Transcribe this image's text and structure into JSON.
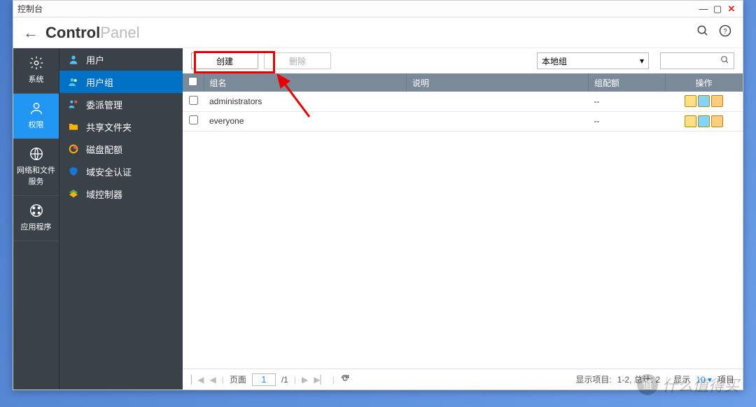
{
  "window": {
    "title": "控制台"
  },
  "header": {
    "brand_strong": "Control",
    "brand_light": "Panel"
  },
  "rail": {
    "items": [
      {
        "label": "系统"
      },
      {
        "label": "权限"
      },
      {
        "label": "网络和文件服务"
      },
      {
        "label": "应用程序"
      }
    ]
  },
  "sidebar": {
    "items": [
      {
        "label": "用户"
      },
      {
        "label": "用户组"
      },
      {
        "label": "委派管理"
      },
      {
        "label": "共享文件夹"
      },
      {
        "label": "磁盘配额"
      },
      {
        "label": "域安全认证"
      },
      {
        "label": "域控制器"
      }
    ]
  },
  "toolbar": {
    "create": "创建",
    "delete": "删除",
    "scope": "本地组"
  },
  "table": {
    "headers": {
      "name": "组名",
      "desc": "说明",
      "quota": "组配额",
      "ops": "操作"
    },
    "rows": [
      {
        "name": "administrators",
        "desc": "",
        "quota": "--"
      },
      {
        "name": "everyone",
        "desc": "",
        "quota": "--"
      }
    ]
  },
  "pager": {
    "page_label": "页面",
    "page_current": "1",
    "page_total": "/1",
    "summary_prefix": "显示项目:",
    "summary_range": "1-2, 总计:  2",
    "show_label": "显示",
    "page_size": "10",
    "items_label": "项目"
  },
  "watermark": {
    "text": "什么值得买",
    "badge": "值"
  }
}
